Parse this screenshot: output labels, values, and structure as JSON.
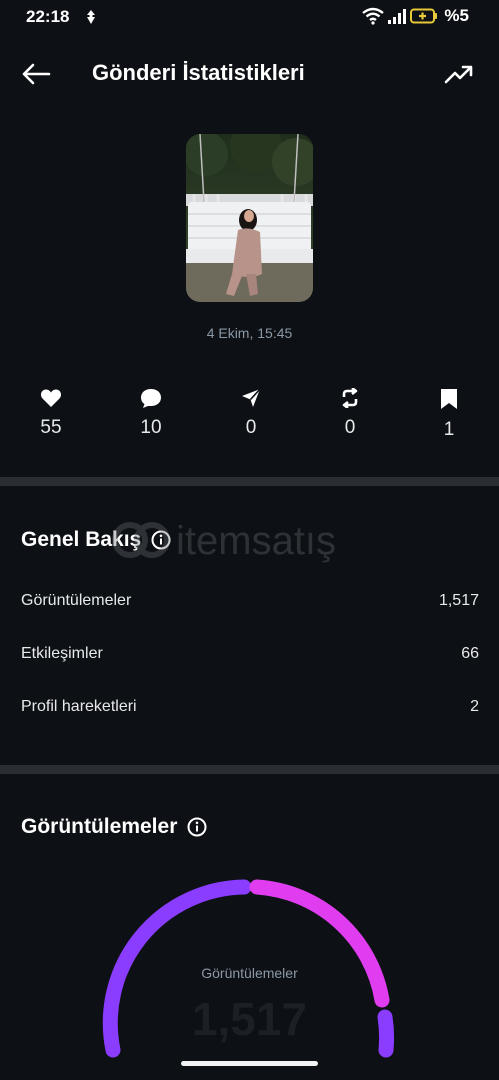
{
  "status_bar": {
    "time": "22:18",
    "battery": "%5"
  },
  "header": {
    "title": "Gönderi İstatistikleri"
  },
  "post": {
    "date": "4 Ekim, 15:45"
  },
  "engagement": [
    {
      "icon": "heart-icon",
      "count": "55"
    },
    {
      "icon": "reply-icon",
      "count": "10"
    },
    {
      "icon": "share-icon",
      "count": "0"
    },
    {
      "icon": "repost-icon",
      "count": "0"
    },
    {
      "icon": "bookmark-icon",
      "count": "1"
    }
  ],
  "overview": {
    "title": "Genel Bakış",
    "rows": [
      {
        "label": "Görüntülemeler",
        "value": "1,517"
      },
      {
        "label": "Etkileşimler",
        "value": "66"
      },
      {
        "label": "Profil hareketleri",
        "value": "2"
      }
    ]
  },
  "views": {
    "title": "Görüntülemeler",
    "gauge_label": "Görüntülemeler",
    "gauge_value": "1,517"
  },
  "watermark": {
    "text": "itemsatış"
  },
  "colors": {
    "background": "#0d1014",
    "divider": "#2a2e33",
    "gauge_purple": "#8b3dff",
    "gauge_pink": "#e03df0"
  }
}
